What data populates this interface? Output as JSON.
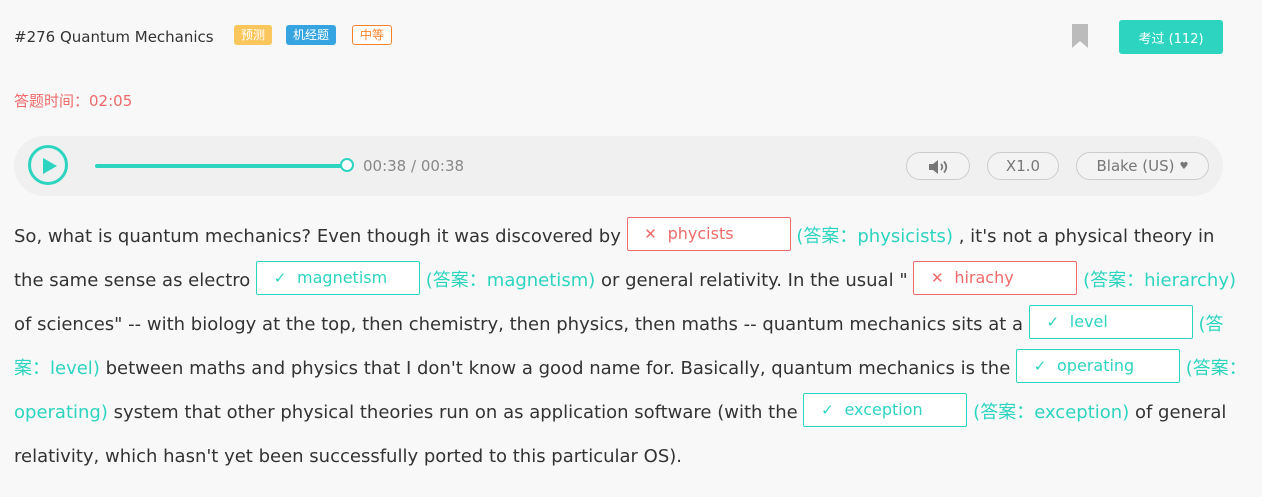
{
  "header": {
    "question_title": "#276 Quantum Mechanics",
    "tags": [
      "预测",
      "机经题",
      "中等"
    ],
    "take_button_label": "考过 (112)"
  },
  "timer": {
    "label": "答题时间：",
    "value": "02:05"
  },
  "player": {
    "time_display": "00:38 / 00:38",
    "progress": 1.0,
    "speed": "X1.0",
    "voice": "Blake (US)"
  },
  "passage": {
    "text": [
      "So, what is quantum mechanics? Even though it was discovered by ",
      " , it's not a physical theory in the same sense as electro ",
      " or general relativity. In the usual \" ",
      " of sciences\" -- with biology at the top, then chemistry, then physics, then maths -- quantum mechanics sits at a ",
      " between maths and physics that I don't know a good name for. Basically, quantum mechanics is the ",
      " system that other physical theories run on as application software (with the ",
      " of general relativity, which hasn't yet been successfully ported to this particular OS)."
    ],
    "answer_prefix": "(答案：",
    "answer_suffix": ")",
    "blanks": [
      {
        "input": "phycists",
        "correct": false,
        "answer": "physicists"
      },
      {
        "input": "magnetism",
        "correct": true,
        "answer": "magnetism"
      },
      {
        "input": "hirachy",
        "correct": false,
        "answer": "hierarchy"
      },
      {
        "input": "level",
        "correct": true,
        "answer": "level"
      },
      {
        "input": "operating",
        "correct": true,
        "answer": "operating"
      },
      {
        "input": "exception",
        "correct": true,
        "answer": "exception"
      }
    ]
  },
  "colors": {
    "accent": "#2dd4c0",
    "error": "#ef6a6a",
    "tag_predict": "#fbc65b",
    "tag_jijing": "#36a4e0",
    "tag_medium": "#f5822a"
  },
  "icons": {
    "play": "play-icon",
    "bookmark": "bookmark-icon",
    "volume": "volume-icon",
    "wrong": "cross-icon",
    "right": "check-icon"
  }
}
